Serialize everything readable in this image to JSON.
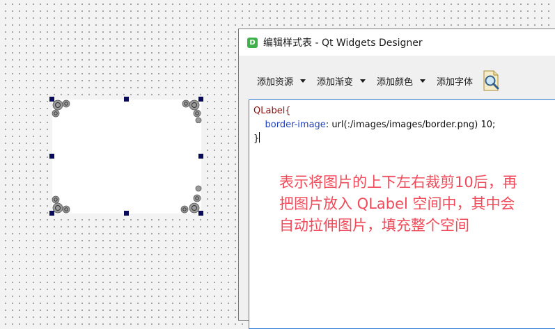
{
  "window": {
    "title": "编辑样式表 - Qt Widgets Designer",
    "app_icon_letter": "D"
  },
  "toolbar": {
    "add_resource": "添加资源",
    "add_gradient": "添加渐变",
    "add_color": "添加颜色",
    "add_font": "添加字体"
  },
  "editor": {
    "line1": "QLabel{",
    "line2_prop": "border-image",
    "line2_value": ": url(:/images/images/border.png) 10;",
    "line3": "}"
  },
  "annotation": {
    "line1": "表示将图片的上下左右裁剪10后，再",
    "line2": "把图片放入 QLabel 空间中，其中会",
    "line3": "自动拉伸图片，填充整个空间"
  },
  "colors": {
    "selector": "#8a1010",
    "property": "#1f3fbf",
    "annotation": "#f04a5a",
    "editor_border": "#2b7bd6",
    "handle": "#0a0a5a"
  }
}
